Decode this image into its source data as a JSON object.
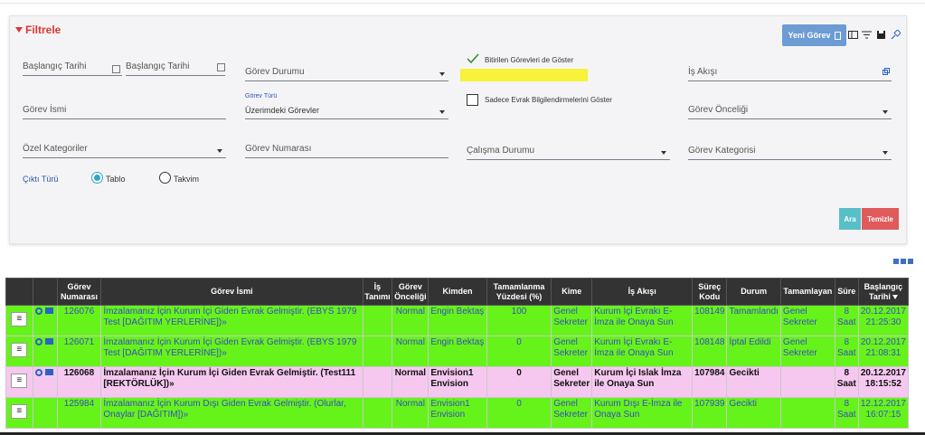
{
  "filter": {
    "title": "Filtrele",
    "new_task_button": "Yeni Görev",
    "fields": {
      "start_date_1": "Başlangıç Tarihi",
      "start_date_2": "Başlangıç Tarihi",
      "task_status": "Görev Durumu",
      "show_completed": "Bitirilen Görevleri de Göster",
      "workflow": "İş Akışı",
      "task_name": "Görev İsmi",
      "task_type_label": "Görev Türü",
      "task_type_value": "Üzerimdeki Görevler",
      "only_doc_info": "Sadece Evrak Bilgilendirmelerini Göster",
      "task_priority": "Görev Önceliği",
      "special_categories": "Özel Kategoriler",
      "task_number": "Görev Numarası",
      "work_status": "Çalışma Durumu",
      "task_category": "Görev Kategorisi",
      "output_type": "Çıktı Türü",
      "opt_table": "Tablo",
      "opt_calendar": "Takvim"
    },
    "search_button": "Ara",
    "clear_button": "Temizle"
  },
  "table": {
    "headers": [
      "",
      "",
      "Görev Numarası",
      "Görev İsmi",
      "İş Tanımı",
      "Görev Önceliği",
      "Kimden",
      "Tamamlanma Yüzdesi (%)",
      "Kime",
      "İş Akışı",
      "Süreç Kodu",
      "Durum",
      "Tamamlayan",
      "Süre",
      "Başlangıç Tarihi"
    ],
    "rows": [
      {
        "no": "126076",
        "name": "İmzalamanız İçin Kurum İçi Giden Evrak Gelmiştir. (EBYS 1979 Test [DAĞITIM YERLERİNE])»",
        "def": "",
        "priority": "Normal",
        "from": "Engin Bektaş",
        "pct": "100",
        "to": "Genel Sekreter",
        "flow": "Kurum İçi Evrakı E-İmza ile Onaya Sun",
        "code": "108149",
        "status": "Tamamlandı",
        "done_by": "Genel Sekreter",
        "dur": "8 Saat",
        "start": "20.12.2017 21:25:30"
      },
      {
        "no": "126071",
        "name": "İmzalamanız İçin Kurum İçi Giden Evrak Gelmiştir. (EBYS 1979 Test [DAĞITIM YERLERİNE])»",
        "def": "",
        "priority": "Normal",
        "from": "Engin Bektaş",
        "pct": "0",
        "to": "Genel Sekreter",
        "flow": "Kurum İçi Evrakı E-İmza ile Onaya Sun",
        "code": "108148",
        "status": "İptal Edildi",
        "done_by": "Genel Sekreter",
        "dur": "8 Saat",
        "start": "20.12.2017 21:08:31"
      },
      {
        "no": "126068",
        "name": "İmzalamanız İçin Kurum İçi Giden Evrak Gelmiştir. (Test111 [REKTÖRLÜK])»",
        "def": "",
        "priority": "Normal",
        "from": "Envision1 Envision",
        "pct": "0",
        "to": "Genel Sekreter",
        "flow": "Kurum İçi Islak İmza ile Onaya Sun",
        "code": "107984",
        "status": "Gecikti",
        "done_by": "",
        "dur": "8 Saat",
        "start": "20.12.2017 18:15:52"
      },
      {
        "no": "125984",
        "name": "İmzalamanız İçin Kurum Dışı Giden Evrak Gelmiştir. (Olurlar, Onaylar [DAĞITIM])»",
        "def": "",
        "priority": "Normal",
        "from": "Envision1 Envision",
        "pct": "0",
        "to": "Genel Sekreter",
        "flow": "Kurum Dışı E-İmza ile Onaya Sun",
        "code": "107939",
        "status": "Gecikti",
        "done_by": "",
        "dur": "8 Saat",
        "start": "12.12.2017 16:07:15"
      }
    ]
  }
}
